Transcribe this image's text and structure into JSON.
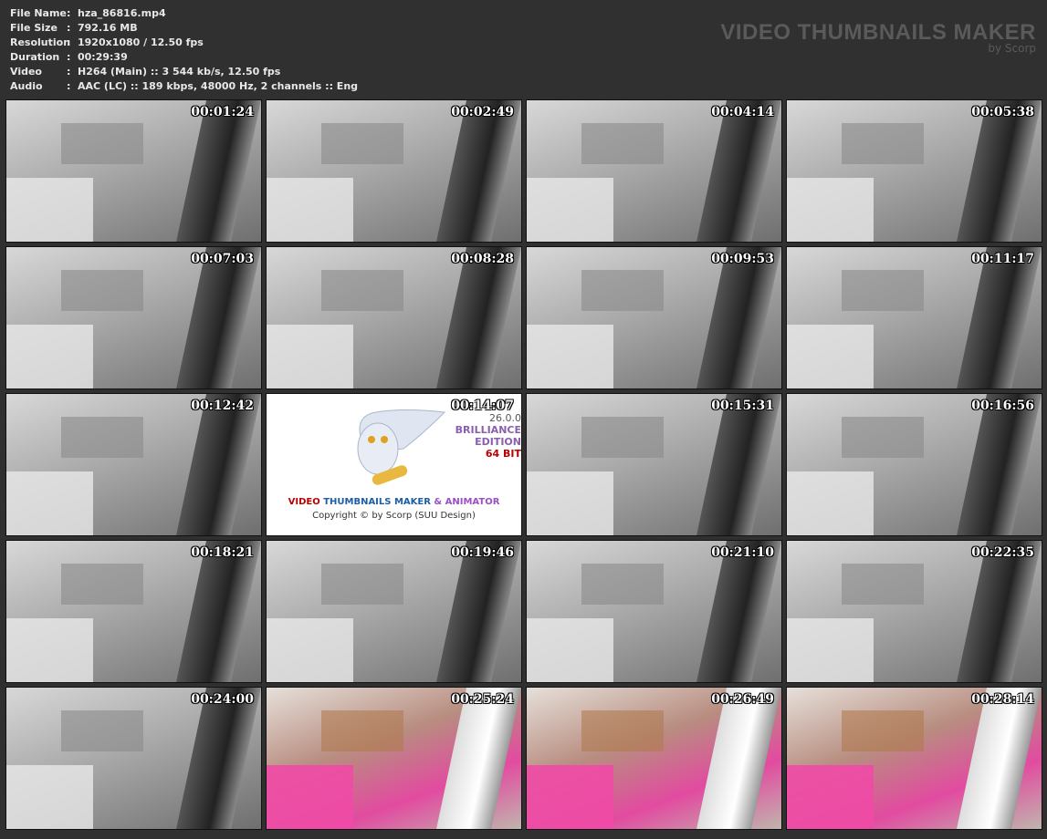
{
  "info": [
    {
      "label": "File Name",
      "value": "hza_86816.mp4"
    },
    {
      "label": "File Size",
      "value": "792.16 MB"
    },
    {
      "label": "Resolution",
      "value": "1920x1080 / 12.50 fps"
    },
    {
      "label": "Duration",
      "value": "00:29:39"
    },
    {
      "label": "Video",
      "value": "H264 (Main) :: 3 544 kb/s, 12.50 fps"
    },
    {
      "label": "Audio",
      "value": "AAC (LC) :: 189 kbps, 48000 Hz, 2 channels :: Eng"
    }
  ],
  "brand": {
    "title": "VIDEO THUMBNAILS MAKER",
    "subtitle": "by Scorp"
  },
  "thumbnails": [
    "00:01:24",
    "00:02:49",
    "00:04:14",
    "00:05:38",
    "00:07:03",
    "00:08:28",
    "00:09:53",
    "00:11:17",
    "00:12:42",
    "00:14:07",
    "00:15:31",
    "00:16:56",
    "00:18:21",
    "00:19:46",
    "00:21:10",
    "00:22:35",
    "00:24:00",
    "00:25:24",
    "00:26:49",
    "00:28:14"
  ],
  "logo": {
    "version": "26.0.0",
    "edition1": "BRILLIANCE",
    "edition2": "EDITION",
    "bits": "64 BIT",
    "title_a": "VIDEO",
    "title_b": "THUMBNAILS MAKER",
    "title_c": "& ANIMATOR",
    "copyright": "Copyright © by Scorp (SUU Design)"
  }
}
